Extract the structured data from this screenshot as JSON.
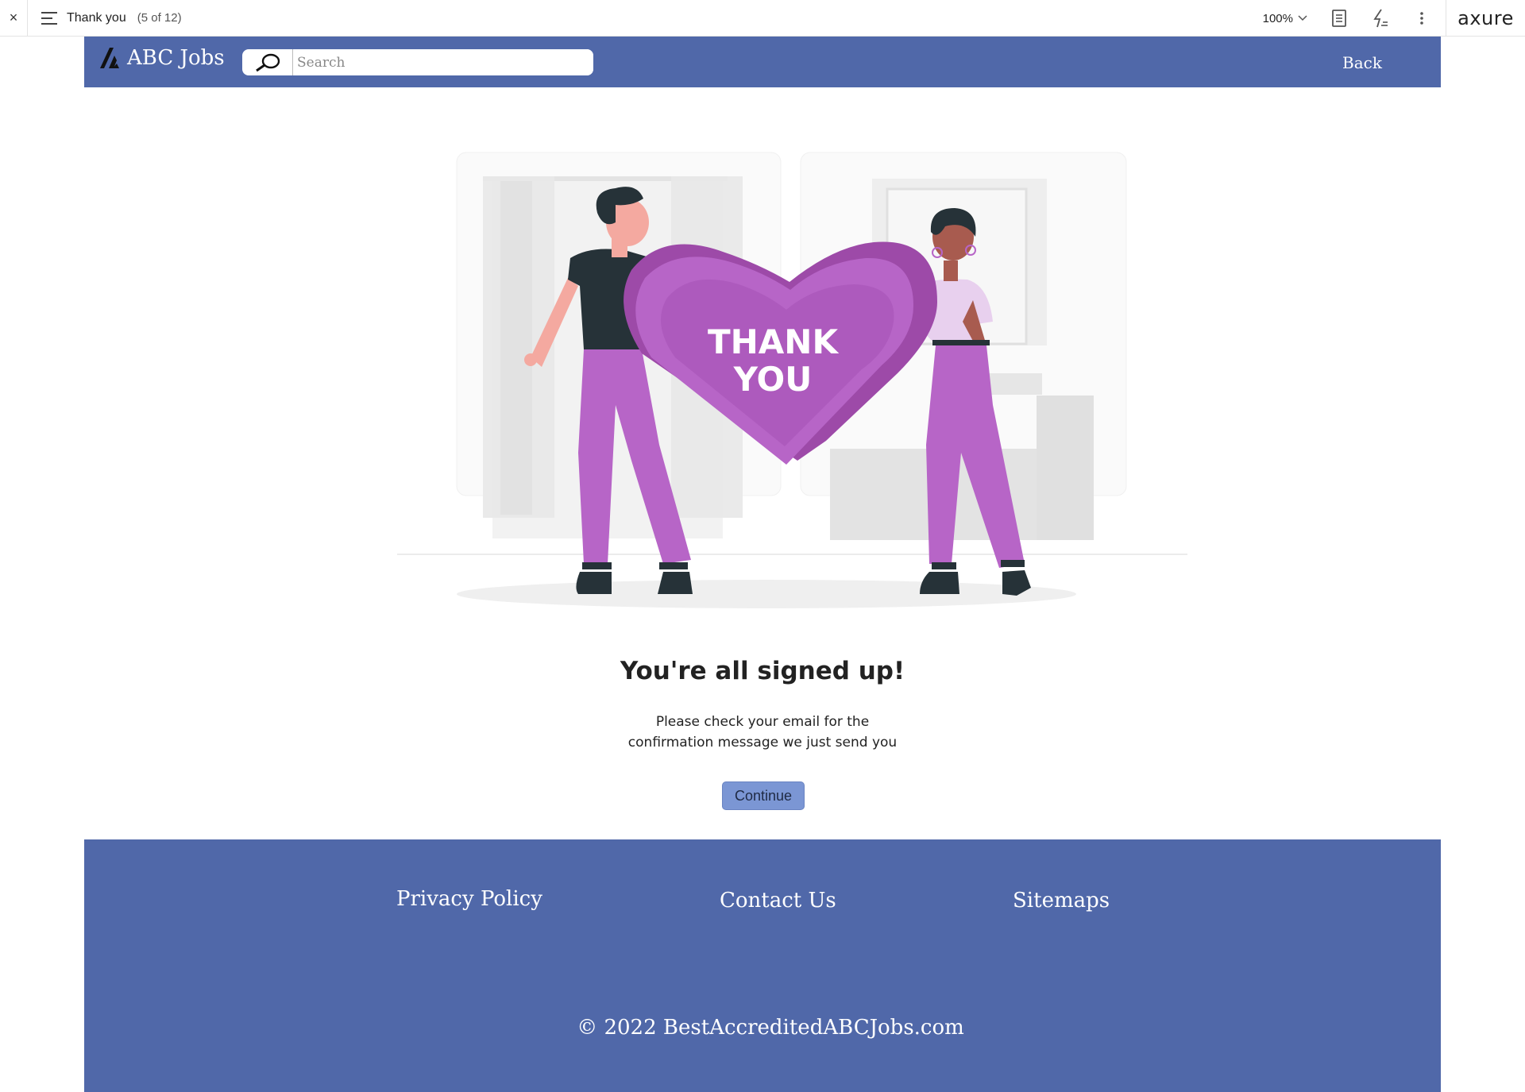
{
  "axure_bar": {
    "close_glyph": "×",
    "page_title": "Thank you",
    "page_count": "(5 of 12)",
    "zoom": "100%",
    "brand": "axure",
    "icons": [
      "close-icon",
      "page-menu-icon",
      "chevron-down-icon",
      "notes-icon",
      "interactions-icon",
      "more-options-icon"
    ]
  },
  "header": {
    "logo_text": "ABC Jobs",
    "search_placeholder": "Search",
    "back_label": "Back",
    "color": "#5068a9"
  },
  "illustration": {
    "heart_line1": "THANK",
    "heart_line2": "YOU"
  },
  "main": {
    "headline": "You're all signed up!",
    "subtext_line1": "Please check your email for the",
    "subtext_line2": "confirmation message we just send you",
    "continue_label": "Continue",
    "button_color": "#7b96d4"
  },
  "footer": {
    "links": [
      "Privacy Policy",
      "Contact Us",
      "Sitemaps"
    ],
    "copyright": "© 2022 BestAccreditedABCJobs.com",
    "color": "#5068a9"
  }
}
